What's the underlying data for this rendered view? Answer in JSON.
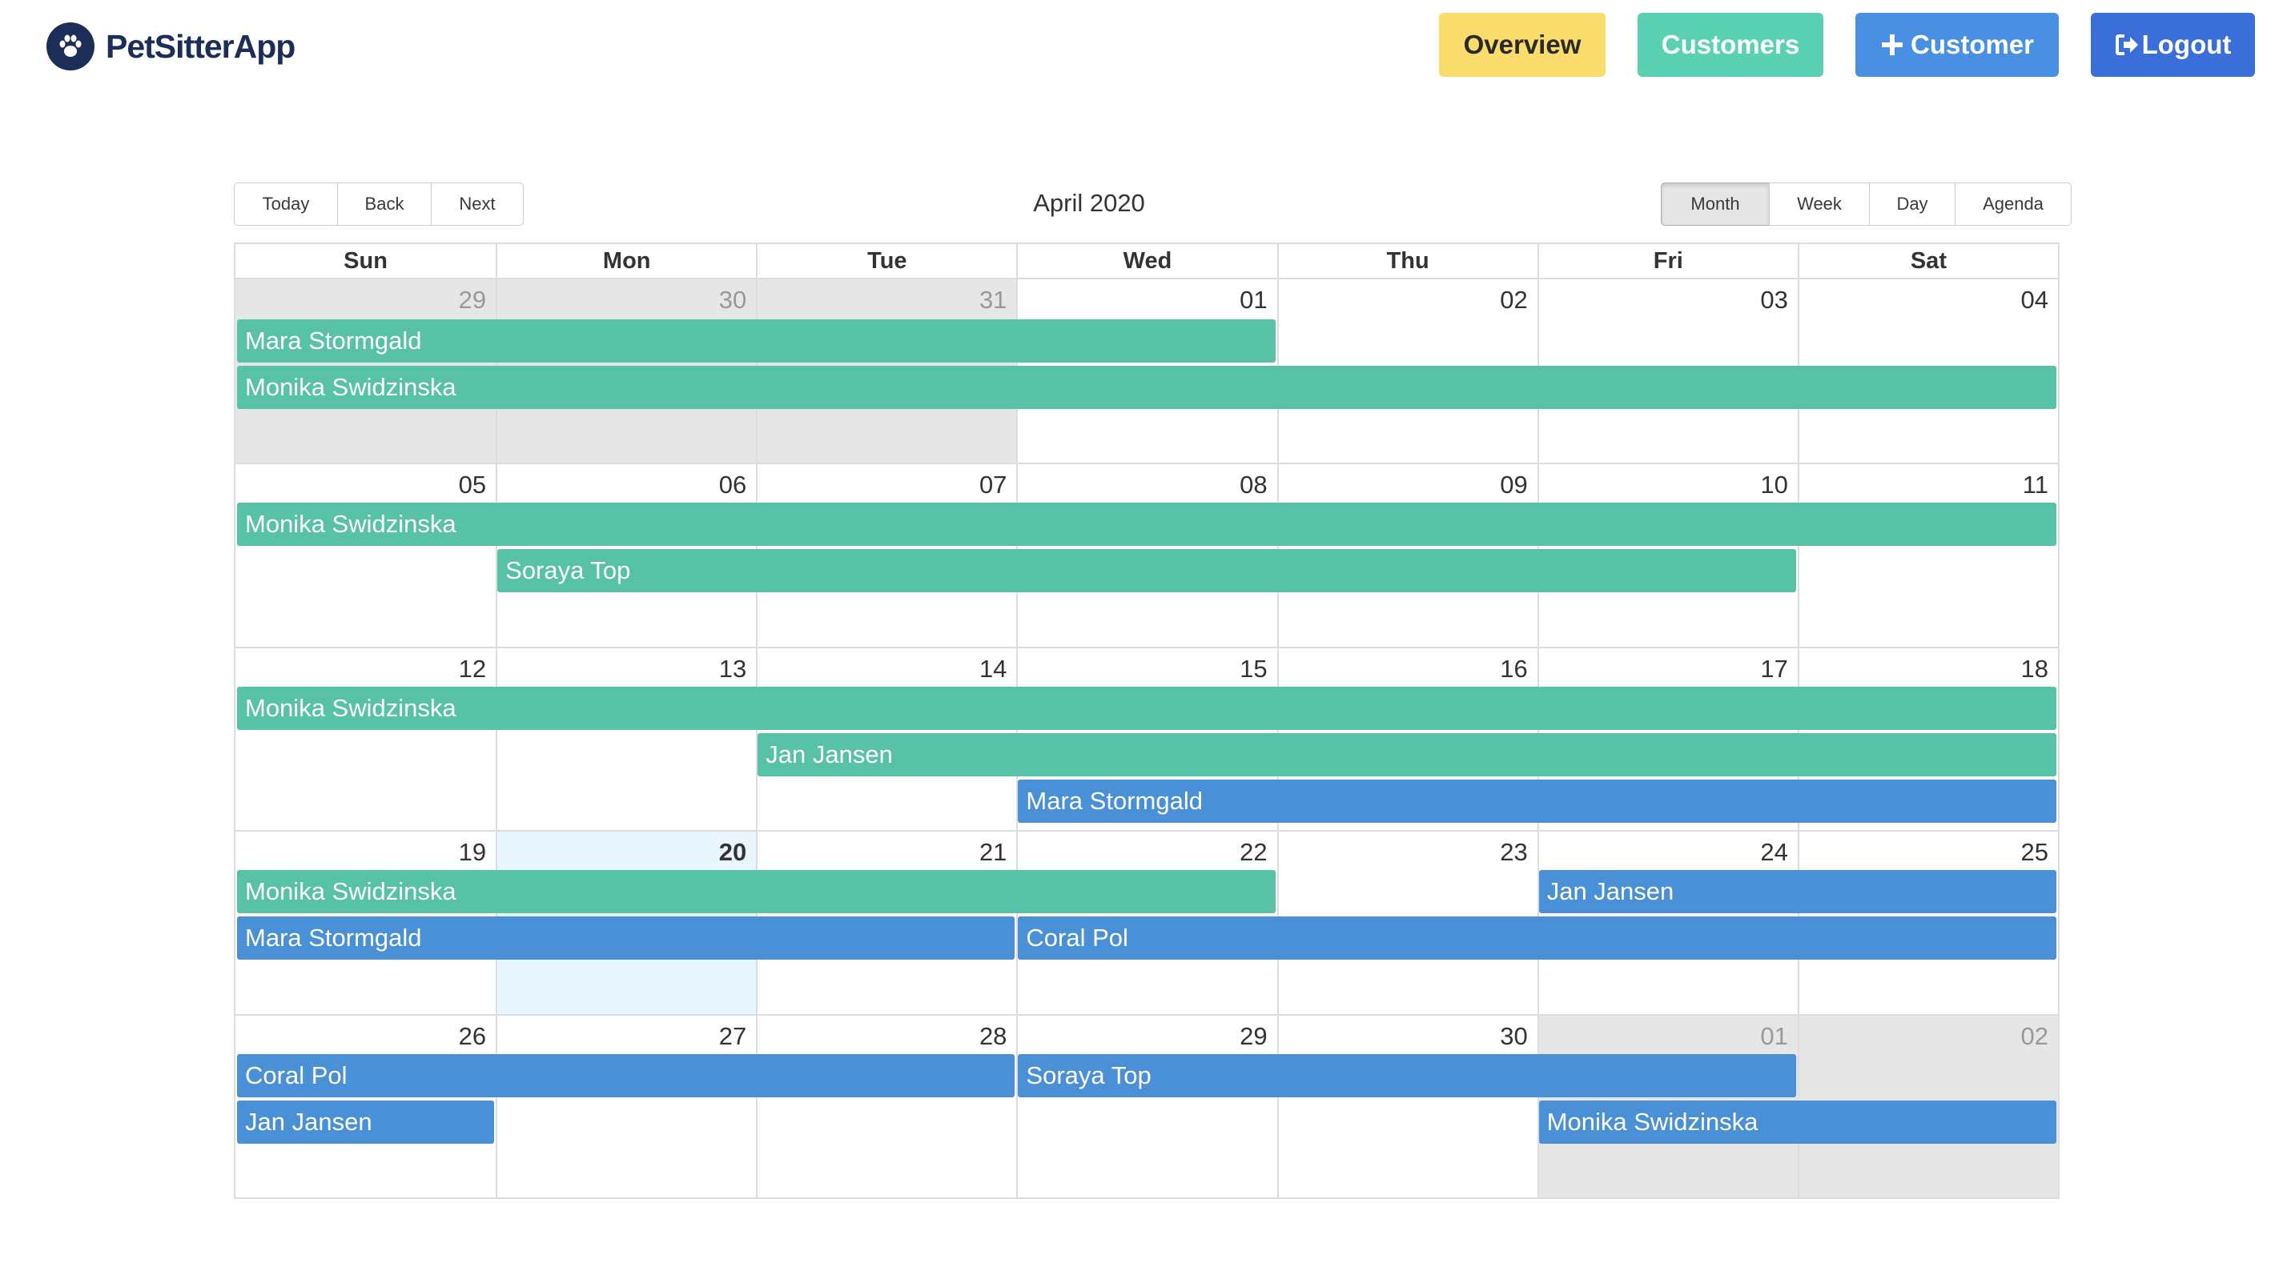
{
  "app": {
    "name": "PetSitterApp"
  },
  "nav": {
    "overview": "Overview",
    "customers": "Customers",
    "add_customer": "Customer",
    "logout": "Logout"
  },
  "toolbar": {
    "today": "Today",
    "back": "Back",
    "next": "Next",
    "label": "April 2020",
    "views": [
      "Month",
      "Week",
      "Day",
      "Agenda"
    ],
    "active_view": "Month"
  },
  "calendar": {
    "weekdays": [
      "Sun",
      "Mon",
      "Tue",
      "Wed",
      "Thu",
      "Fri",
      "Sat"
    ],
    "weeks": [
      [
        {
          "d": "29",
          "off": true
        },
        {
          "d": "30",
          "off": true
        },
        {
          "d": "31",
          "off": true
        },
        {
          "d": "01"
        },
        {
          "d": "02"
        },
        {
          "d": "03"
        },
        {
          "d": "04"
        }
      ],
      [
        {
          "d": "05"
        },
        {
          "d": "06"
        },
        {
          "d": "07"
        },
        {
          "d": "08"
        },
        {
          "d": "09"
        },
        {
          "d": "10"
        },
        {
          "d": "11"
        }
      ],
      [
        {
          "d": "12"
        },
        {
          "d": "13"
        },
        {
          "d": "14"
        },
        {
          "d": "15"
        },
        {
          "d": "16"
        },
        {
          "d": "17"
        },
        {
          "d": "18"
        }
      ],
      [
        {
          "d": "19"
        },
        {
          "d": "20",
          "today": true
        },
        {
          "d": "21"
        },
        {
          "d": "22"
        },
        {
          "d": "23"
        },
        {
          "d": "24"
        },
        {
          "d": "25"
        }
      ],
      [
        {
          "d": "26"
        },
        {
          "d": "27"
        },
        {
          "d": "28"
        },
        {
          "d": "29"
        },
        {
          "d": "30"
        },
        {
          "d": "01",
          "off": true
        },
        {
          "d": "02",
          "off": true
        }
      ]
    ],
    "events": [
      {
        "title": "Mara Stormgald",
        "week": 0,
        "start": 0,
        "end": 3,
        "row": 0,
        "kind": "green"
      },
      {
        "title": "Monika Swidzinska",
        "week": 0,
        "start": 0,
        "end": 6,
        "row": 1,
        "kind": "green"
      },
      {
        "title": "Monika Swidzinska",
        "week": 1,
        "start": 0,
        "end": 6,
        "row": 0,
        "kind": "green"
      },
      {
        "title": "Soraya Top",
        "week": 1,
        "start": 1,
        "end": 5,
        "row": 1,
        "kind": "green"
      },
      {
        "title": "Monika Swidzinska",
        "week": 2,
        "start": 0,
        "end": 6,
        "row": 0,
        "kind": "green"
      },
      {
        "title": "Jan Jansen",
        "week": 2,
        "start": 2,
        "end": 6,
        "row": 1,
        "kind": "green"
      },
      {
        "title": "Mara Stormgald",
        "week": 2,
        "start": 3,
        "end": 6,
        "row": 2,
        "kind": "blue"
      },
      {
        "title": "Monika Swidzinska",
        "week": 3,
        "start": 0,
        "end": 3,
        "row": 0,
        "kind": "green"
      },
      {
        "title": "Jan Jansen",
        "week": 3,
        "start": 5,
        "end": 6,
        "row": 0,
        "kind": "blue"
      },
      {
        "title": "Mara Stormgald",
        "week": 3,
        "start": 0,
        "end": 2,
        "row": 1,
        "kind": "blue"
      },
      {
        "title": "Coral Pol",
        "week": 3,
        "start": 3,
        "end": 6,
        "row": 1,
        "kind": "blue"
      },
      {
        "title": "Coral Pol",
        "week": 4,
        "start": 0,
        "end": 2,
        "row": 0,
        "kind": "blue"
      },
      {
        "title": "Soraya Top",
        "week": 4,
        "start": 3,
        "end": 5,
        "row": 0,
        "kind": "blue"
      },
      {
        "title": "Jan Jansen",
        "week": 4,
        "start": 0,
        "end": 0,
        "row": 1,
        "kind": "blue"
      },
      {
        "title": "Monika Swidzinska",
        "week": 4,
        "start": 5,
        "end": 6,
        "row": 1,
        "kind": "blue"
      }
    ]
  },
  "colors": {
    "overview": "#f9dc6c",
    "customers": "#5ad1b3",
    "add_customer": "#4a90e2",
    "logout": "#3a6ed8",
    "event_green": "#57c2a6",
    "event_blue": "#4a90d6",
    "brand": "#1c2e57"
  },
  "icons": {
    "logo": "paw-icon",
    "add_customer": "plus-icon",
    "logout": "sign-out-icon"
  }
}
